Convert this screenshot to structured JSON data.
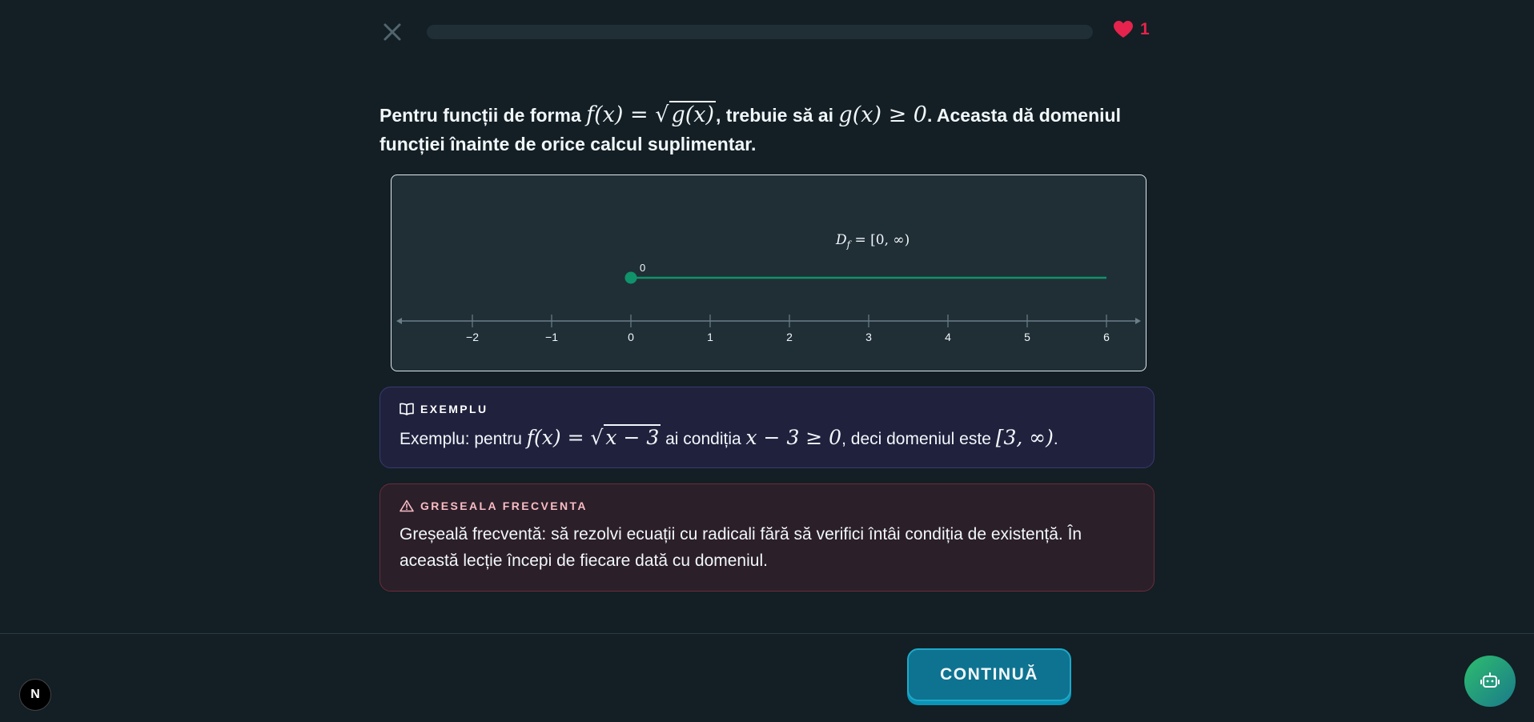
{
  "header": {
    "close_icon": "close-icon",
    "progress": 0,
    "hearts_count": "1",
    "heart_icon": "heart-icon",
    "heart_color": "#e5234d"
  },
  "prompt": {
    "t1": "Pentru funcții de forma ",
    "m1": "f(x) = ",
    "m1_rad": "g(x)",
    "t2": ", trebuie să ai ",
    "m2": "g(x) ≥ 0",
    "t3": ". Aceasta dă domeniul funcției înainte de orice calcul suplimentar."
  },
  "number_line": {
    "ticks": [
      "−2",
      "−1",
      "0",
      "1",
      "2",
      "3",
      "4",
      "5",
      "6"
    ],
    "domain_label_main": "D",
    "domain_label_sub": "f",
    "domain_label_rest": " = [0, ∞)",
    "point_label": "0",
    "closed_point": 0,
    "ray_to": 6,
    "ray_color": "#10936a"
  },
  "example": {
    "icon": "book-icon",
    "title": "EXEMPLU",
    "t1": "Exemplu: pentru ",
    "m1": "f(x) = ",
    "m1_rad": "x − 3",
    "t2": " ai condiția ",
    "m2": "x − 3 ≥ 0",
    "t3": ", deci domeniul este ",
    "m3": "[3, ∞)",
    "t4": "."
  },
  "warning": {
    "icon": "warning-icon",
    "title": "GRESEALA FRECVENTA",
    "text": "Greșeală frecventă: să rezolvi ecuații cu radicali fără să verifici întâi condiția de existență. În această lecție începi de fiecare dată cu domeniul."
  },
  "footer": {
    "continue_label": "CONTINUĂ",
    "n_badge": "N",
    "bot_icon": "robot-icon"
  }
}
